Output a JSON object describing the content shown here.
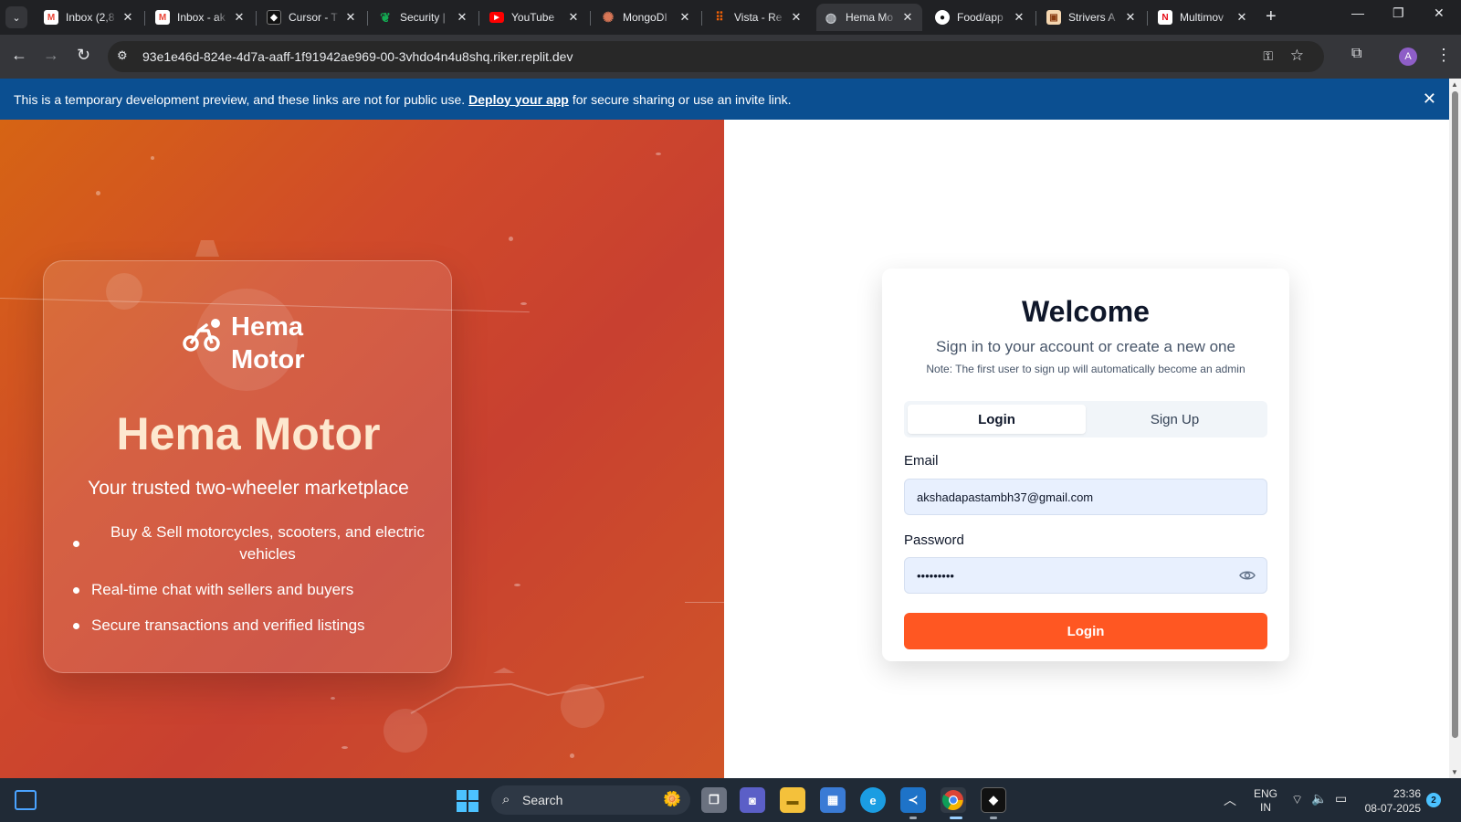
{
  "browser": {
    "tabs": [
      {
        "title": "Inbox (2,8",
        "favicon": "gmail-icon",
        "active": false
      },
      {
        "title": "Inbox - ak",
        "favicon": "gmail-icon",
        "active": false
      },
      {
        "title": "Cursor - T",
        "favicon": "cursor-icon",
        "active": false
      },
      {
        "title": "Security |",
        "favicon": "mongodb-leaf-icon",
        "active": false
      },
      {
        "title": "YouTube",
        "favicon": "youtube-icon",
        "active": false
      },
      {
        "title": "MongoDI",
        "favicon": "claude-icon",
        "active": false
      },
      {
        "title": "Vista - Re",
        "favicon": "replit-icon",
        "active": false
      },
      {
        "title": "Hema Mo",
        "favicon": "globe-icon",
        "active": true
      },
      {
        "title": "Food/app",
        "favicon": "github-icon",
        "active": false
      },
      {
        "title": "Strivers A",
        "favicon": "striver-icon",
        "active": false
      },
      {
        "title": "Multimov",
        "favicon": "netflix-icon",
        "active": false
      }
    ],
    "url": "93e1e46d-824e-4d7a-aaff-1f91942ae969-00-3vhdo4n4u8shq.riker.replit.dev",
    "profile_initial": "A"
  },
  "banner": {
    "text_before": "This is a temporary development preview, and these links are not for public use.",
    "link": "Deploy your app",
    "text_after": "for secure sharing or use an invite link."
  },
  "hero": {
    "logo_line1": "Hema",
    "logo_line2": "Motor",
    "title": "Hema Motor",
    "subtitle": "Your trusted two-wheeler marketplace",
    "features": [
      "Buy & Sell motorcycles, scooters, and electric vehicles",
      "Real-time chat with sellers and buyers",
      "Secure transactions and verified listings"
    ]
  },
  "auth": {
    "title": "Welcome",
    "subtitle": "Sign in to your account or create a new one",
    "note": "Note: The first user to sign up will automatically become an admin",
    "tab_login": "Login",
    "tab_signup": "Sign Up",
    "email_label": "Email",
    "email_value": "akshadapastambh37@gmail.com",
    "password_label": "Password",
    "password_value": "•••••••••",
    "submit": "Login"
  },
  "taskbar": {
    "search": "Search",
    "lang_line1": "ENG",
    "lang_line2": "IN",
    "time": "23:36",
    "date": "08-07-2025",
    "notifications": "2"
  },
  "colors": {
    "accent": "#ff5722",
    "banner": "#0b4f91",
    "hero_start": "#d66414",
    "hero_end": "#c84030"
  }
}
